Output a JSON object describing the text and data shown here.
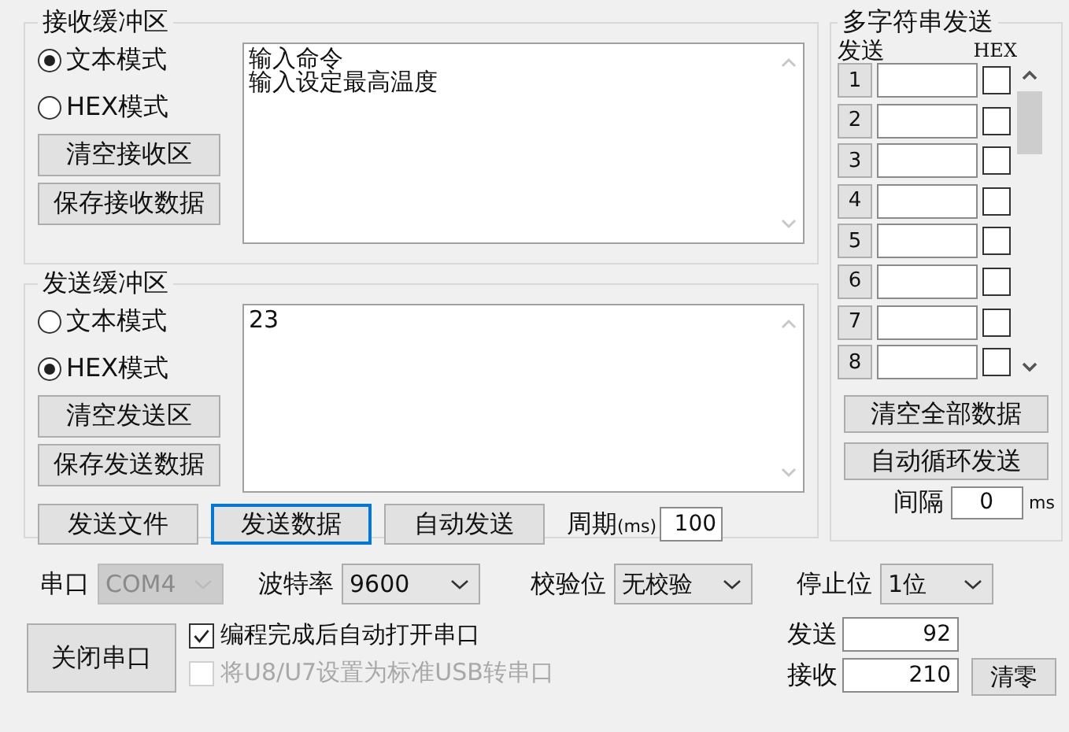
{
  "receive_buffer": {
    "title": "接收缓冲区",
    "modes": [
      {
        "label": "文本模式",
        "selected": true
      },
      {
        "label": "HEX模式",
        "selected": false
      }
    ],
    "buttons": [
      "清空接收区",
      "保存接收数据"
    ],
    "lines": [
      "输入命令",
      "输入设定最高温度"
    ]
  },
  "send_buffer": {
    "title": "发送缓冲区",
    "modes": [
      {
        "label": "文本模式",
        "selected": false
      },
      {
        "label": "HEX模式",
        "selected": true
      }
    ],
    "buttons": [
      "清空发送区",
      "保存发送数据"
    ],
    "lines": [
      "23"
    ],
    "actions": [
      {
        "label": "发送文件",
        "focused": false
      },
      {
        "label": "发送数据",
        "focused": true
      },
      {
        "label": "自动发送",
        "focused": false
      }
    ],
    "period": {
      "label": "周期",
      "unit": "(ms)",
      "value": "100"
    }
  },
  "multi_string_send": {
    "title": "多字符串发送",
    "send_header": "发送",
    "hex_header": "HEX",
    "rows": [
      {
        "number": "1",
        "checked": false
      },
      {
        "number": "2",
        "checked": false
      },
      {
        "number": "3",
        "checked": false
      },
      {
        "number": "4",
        "checked": false
      },
      {
        "number": "5",
        "checked": false
      },
      {
        "number": "6",
        "checked": false
      },
      {
        "number": "7",
        "checked": false
      },
      {
        "number": "8",
        "checked": false
      }
    ],
    "buttons": [
      "清空全部数据",
      "自动循环发送"
    ],
    "interval": {
      "label": "间隔",
      "value": "0",
      "unit": "ms"
    }
  },
  "settings": [
    {
      "label": "串口",
      "value": "COM4",
      "disabled": true
    },
    {
      "label": "波特率",
      "value": "9600",
      "disabled": false
    },
    {
      "label": "校验位",
      "value": "无校验",
      "disabled": false
    },
    {
      "label": "停止位",
      "value": "1位",
      "disabled": false
    }
  ],
  "close_port_button": "关闭串口",
  "options": [
    {
      "label": "编程完成后自动打开串口",
      "checked": true,
      "disabled": false
    },
    {
      "label": "将U8/U7设置为标准USB转串口",
      "checked": false,
      "disabled": true
    }
  ],
  "counters": [
    {
      "label": "发送",
      "value": "92"
    },
    {
      "label": "接收",
      "value": "210"
    }
  ],
  "clear_button": "清零"
}
